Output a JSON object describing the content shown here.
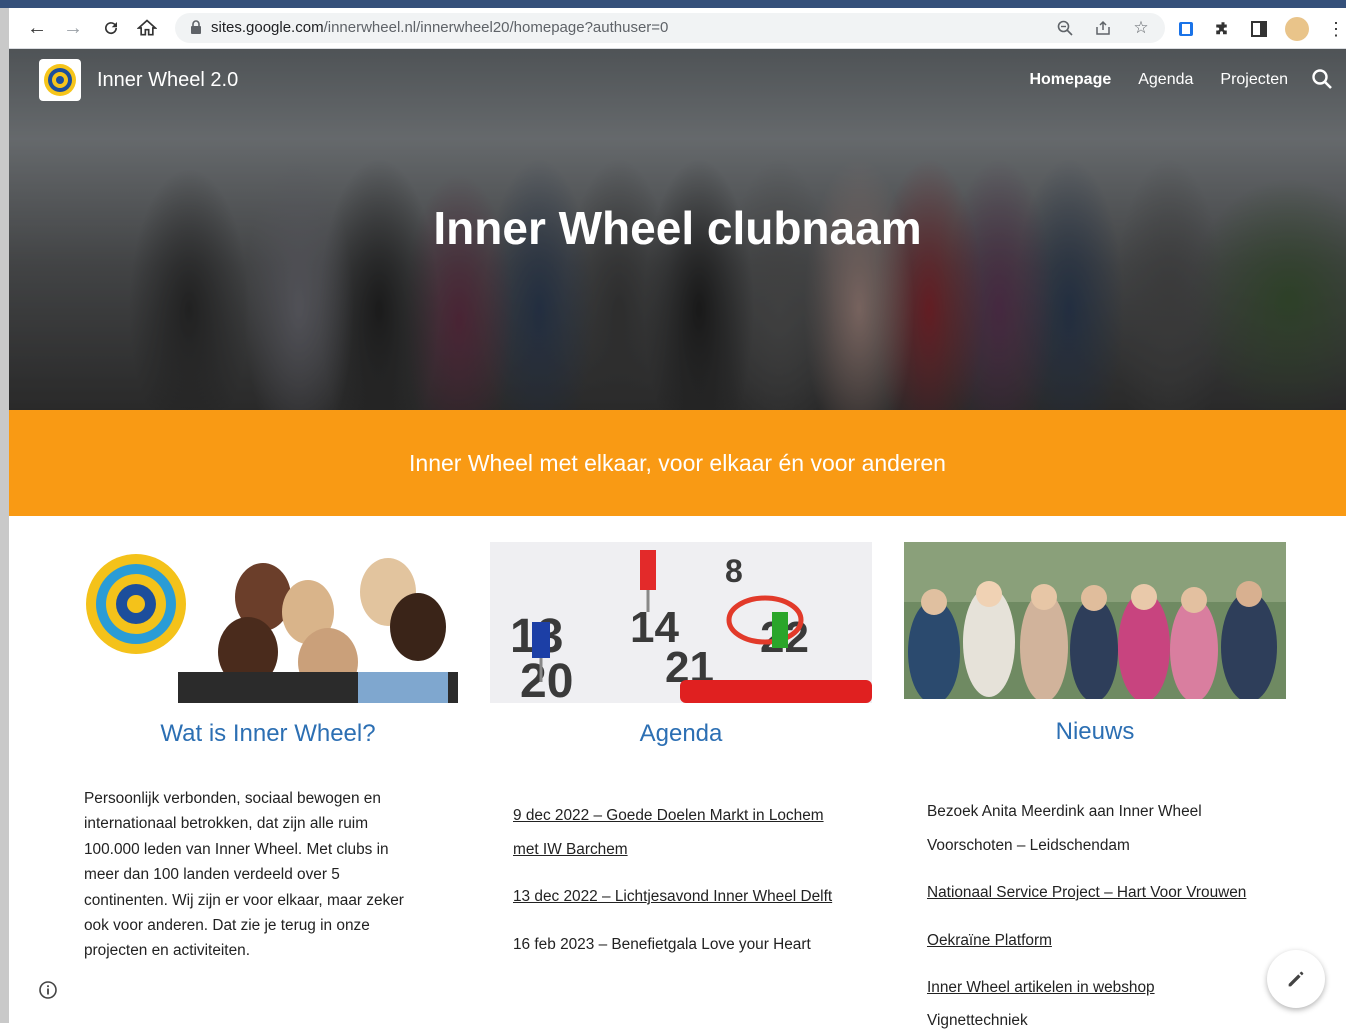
{
  "browser": {
    "url_host": "sites.google.com",
    "url_path": "/innerwheel.nl/innerwheel20/homepage?authuser=0"
  },
  "site": {
    "name": "Inner Wheel 2.0",
    "nav": [
      {
        "label": "Homepage",
        "active": true
      },
      {
        "label": "Agenda",
        "active": false
      },
      {
        "label": "Projecten",
        "active": false
      }
    ],
    "hero_title": "Inner Wheel clubnaam",
    "tagline": "Inner Wheel met elkaar, voor elkaar én voor anderen"
  },
  "columns": {
    "about": {
      "title": "Wat is Inner Wheel?",
      "lines": [
        "Persoonlijk verbonden, sociaal bewogen en",
        "internationaal betrokken, dat zijn alle ruim",
        "100.000 leden van Inner Wheel. Met clubs in",
        "meer dan 100 landen verdeeld over 5",
        "continenten. Wij zijn er voor elkaar, maar zeker",
        "ook voor anderen. Dat zie je terug in onze",
        "projecten en activiteiten."
      ]
    },
    "agenda": {
      "title": "Agenda",
      "items": [
        {
          "line1": "9 dec 2022 – Goede Doelen Markt in Lochem ",
          "line2": "met IW Barchem",
          "link": true
        },
        {
          "line1": "13 dec 2022 – Lichtjesavond Inner Wheel Delft",
          "link": true
        },
        {
          "line1": "16 feb 2023 – Benefietgala Love your Heart",
          "link": false
        }
      ]
    },
    "news": {
      "title": "Nieuws",
      "items": [
        {
          "line1": "Bezoek Anita Meerdink aan Inner Wheel",
          "line2": "Voorschoten – Leidschendam",
          "link": false
        },
        {
          "line1": "Nationaal Service Project – Hart Voor Vrouwen",
          "link": true
        },
        {
          "line1": "Oekraïne Platform",
          "link": true
        },
        {
          "line1": "Inner Wheel artikelen in webshop ",
          "link": true
        },
        {
          "line1": "Vignettechniek",
          "link": false
        }
      ]
    }
  },
  "colors": {
    "accent_orange": "#f99a14",
    "title_blue": "#2c6fb3"
  }
}
